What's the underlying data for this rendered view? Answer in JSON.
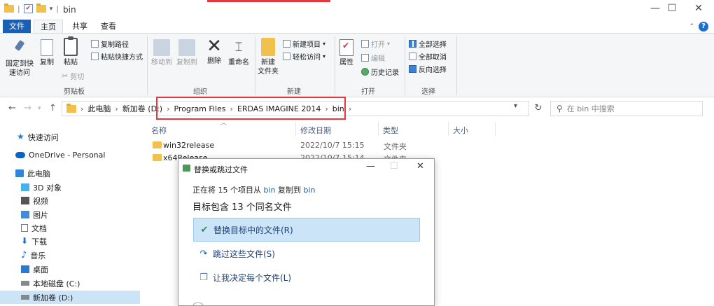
{
  "window": {
    "title": "bin",
    "minimize": "—",
    "maximize": "☐",
    "close": "✕"
  },
  "ribbon_tabs": [
    "文件",
    "主页",
    "共享",
    "查看"
  ],
  "ribbon": {
    "pin": "固定到快\n速访问",
    "copy": "复制",
    "paste": "粘贴",
    "copy_path": "复制路径",
    "paste_shortcut": "粘贴快捷方式",
    "cut": "剪切",
    "clipboard_group": "剪贴板",
    "move_to": "移动到",
    "copy_to": "复制到",
    "delete": "删除",
    "rename": "重命名",
    "organize_group": "组织",
    "new_folder": "新建\n文件夹",
    "new_item": "新建项目",
    "easy_access": "轻松访问",
    "new_group": "新建",
    "properties": "属性",
    "open": "打开",
    "edit": "编辑",
    "history": "历史记录",
    "open_group": "打开",
    "select_all": "全部选择",
    "select_none": "全部取消",
    "invert_selection": "反向选择",
    "select_group": "选择"
  },
  "address": {
    "segments": [
      "此电脑",
      "新加卷 (D:)",
      "Program Files",
      "ERDAS IMAGINE 2014",
      "bin"
    ],
    "search_placeholder": "在 bin 中搜索"
  },
  "nav_pane": [
    {
      "label": "快速访问",
      "icon": "star-icon"
    },
    {
      "label": "OneDrive - Personal",
      "icon": "cloud-icon"
    },
    {
      "label": "此电脑",
      "icon": "computer-icon"
    },
    {
      "label": "3D 对象",
      "icon": "cube-icon"
    },
    {
      "label": "视频",
      "icon": "video-icon"
    },
    {
      "label": "图片",
      "icon": "picture-icon"
    },
    {
      "label": "文档",
      "icon": "document-icon"
    },
    {
      "label": "下载",
      "icon": "download-icon"
    },
    {
      "label": "音乐",
      "icon": "music-icon"
    },
    {
      "label": "桌面",
      "icon": "desktop-icon"
    },
    {
      "label": "本地磁盘 (C:)",
      "icon": "disk-icon"
    },
    {
      "label": "新加卷 (D:)",
      "icon": "disk-icon"
    }
  ],
  "columns": [
    "名称",
    "修改日期",
    "类型",
    "大小"
  ],
  "files": [
    {
      "name": "win32release",
      "date": "2022/10/7 15:15",
      "type": "文件夹"
    },
    {
      "name": "x64Release",
      "date": "2022/10/7 15:14",
      "type": "文件夹"
    }
  ],
  "dialog": {
    "title": "替换或跳过文件",
    "status_prefix": "正在将 15 个项目从",
    "status_src": "bin",
    "status_mid": "复制到",
    "status_dst": "bin",
    "heading": "目标包含 13 个同名文件",
    "options": [
      "替换目标中的文件(R)",
      "跳过这些文件(S)",
      "让我决定每个文件(L)"
    ]
  },
  "colors": {
    "accent": "#1a5fb4",
    "highlight_border": "#e0393e",
    "selection": "#cce4f7"
  }
}
